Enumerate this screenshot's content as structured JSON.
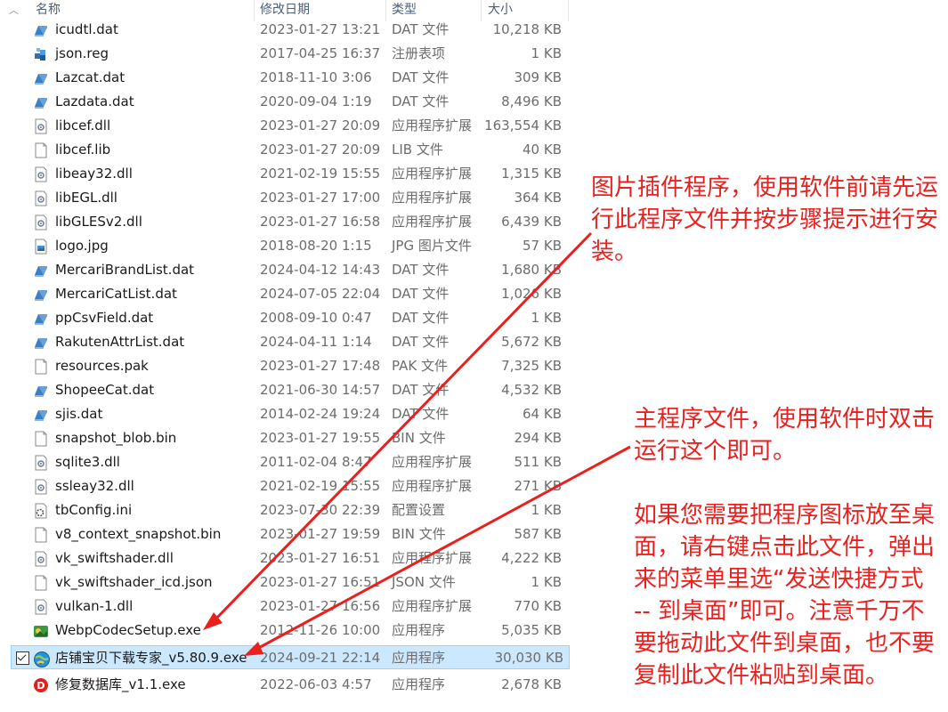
{
  "header": {
    "col_name": "名称",
    "col_date": "修改日期",
    "col_type": "类型",
    "col_size": "大小"
  },
  "files": [
    {
      "name": "icudtl.dat",
      "date": "2023-01-27 13:21",
      "type": "DAT 文件",
      "size": "10,218 KB",
      "icon": "dat-file-icon"
    },
    {
      "name": "json.reg",
      "date": "2017-04-25 16:37",
      "type": "注册表项",
      "size": "1 KB",
      "icon": "registry-file-icon"
    },
    {
      "name": "Lazcat.dat",
      "date": "2018-11-10 3:06",
      "type": "DAT 文件",
      "size": "309 KB",
      "icon": "dat-file-icon"
    },
    {
      "name": "Lazdata.dat",
      "date": "2020-09-04 1:19",
      "type": "DAT 文件",
      "size": "8,496 KB",
      "icon": "dat-file-icon"
    },
    {
      "name": "libcef.dll",
      "date": "2023-01-27 20:09",
      "type": "应用程序扩展",
      "size": "163,554 KB",
      "icon": "dll-file-icon"
    },
    {
      "name": "libcef.lib",
      "date": "2023-01-27 20:09",
      "type": "LIB 文件",
      "size": "40 KB",
      "icon": "blank-file-icon"
    },
    {
      "name": "libeay32.dll",
      "date": "2021-02-19 15:55",
      "type": "应用程序扩展",
      "size": "1,315 KB",
      "icon": "dll-file-icon"
    },
    {
      "name": "libEGL.dll",
      "date": "2023-01-27 17:00",
      "type": "应用程序扩展",
      "size": "364 KB",
      "icon": "dll-file-icon"
    },
    {
      "name": "libGLESv2.dll",
      "date": "2023-01-27 16:58",
      "type": "应用程序扩展",
      "size": "6,439 KB",
      "icon": "dll-file-icon"
    },
    {
      "name": "logo.jpg",
      "date": "2018-08-20 1:15",
      "type": "JPG 图片文件",
      "size": "57 KB",
      "icon": "image-file-icon"
    },
    {
      "name": "MercariBrandList.dat",
      "date": "2024-04-12 14:43",
      "type": "DAT 文件",
      "size": "1,680 KB",
      "icon": "dat-file-icon"
    },
    {
      "name": "MercariCatList.dat",
      "date": "2024-07-05 22:04",
      "type": "DAT 文件",
      "size": "1,026 KB",
      "icon": "dat-file-icon"
    },
    {
      "name": "ppCsvField.dat",
      "date": "2008-09-10 0:47",
      "type": "DAT 文件",
      "size": "1 KB",
      "icon": "dat-file-icon"
    },
    {
      "name": "RakutenAttrList.dat",
      "date": "2024-04-11 1:14",
      "type": "DAT 文件",
      "size": "5,672 KB",
      "icon": "dat-file-icon"
    },
    {
      "name": "resources.pak",
      "date": "2023-01-27 17:48",
      "type": "PAK 文件",
      "size": "7,325 KB",
      "icon": "blank-file-icon"
    },
    {
      "name": "ShopeeCat.dat",
      "date": "2021-06-30 14:57",
      "type": "DAT 文件",
      "size": "4,532 KB",
      "icon": "dat-file-icon"
    },
    {
      "name": "sjis.dat",
      "date": "2014-02-24 19:24",
      "type": "DAT 文件",
      "size": "64 KB",
      "icon": "dat-file-icon"
    },
    {
      "name": "snapshot_blob.bin",
      "date": "2023-01-27 19:55",
      "type": "BIN 文件",
      "size": "294 KB",
      "icon": "blank-file-icon"
    },
    {
      "name": "sqlite3.dll",
      "date": "2011-02-04 8:47",
      "type": "应用程序扩展",
      "size": "511 KB",
      "icon": "dll-file-icon"
    },
    {
      "name": "ssleay32.dll",
      "date": "2021-02-19 15:55",
      "type": "应用程序扩展",
      "size": "271 KB",
      "icon": "dll-file-icon"
    },
    {
      "name": "tbConfig.ini",
      "date": "2023-07-30 22:39",
      "type": "配置设置",
      "size": "1 KB",
      "icon": "ini-file-icon"
    },
    {
      "name": "v8_context_snapshot.bin",
      "date": "2023-01-27 19:59",
      "type": "BIN 文件",
      "size": "587 KB",
      "icon": "blank-file-icon"
    },
    {
      "name": "vk_swiftshader.dll",
      "date": "2023-01-27 16:51",
      "type": "应用程序扩展",
      "size": "4,222 KB",
      "icon": "dll-file-icon"
    },
    {
      "name": "vk_swiftshader_icd.json",
      "date": "2023-01-27 16:51",
      "type": "JSON 文件",
      "size": "1 KB",
      "icon": "blank-file-icon"
    },
    {
      "name": "vulkan-1.dll",
      "date": "2023-01-27 16:56",
      "type": "应用程序扩展",
      "size": "770 KB",
      "icon": "dll-file-icon"
    },
    {
      "name": "WebpCodecSetup.exe",
      "date": "2012-11-26 10:00",
      "type": "应用程序",
      "size": "5,035 KB",
      "icon": "webp-installer-icon"
    },
    {
      "name": "店铺宝贝下载专家_v5.80.9.exe",
      "date": "2024-09-21 22:14",
      "type": "应用程序",
      "size": "30,030 KB",
      "icon": "app-globe-icon",
      "selected": true
    },
    {
      "name": "修复数据库_v1.1.exe",
      "date": "2022-06-03 4:57",
      "type": "应用程序",
      "size": "2,678 KB",
      "icon": "repair-app-icon"
    }
  ],
  "annotations": {
    "annot1": "图片插件程序，使用软件前请先运行此程序文件并按步骤提示进行安装。",
    "annot2": "主程序文件，使用软件时双击运行这个即可。",
    "annot3": "如果您需要把程序图标放至桌面，请右键点击此文件，弹出来的菜单里选“发送快捷方式 -- 到桌面”即可。注意千万不要拖动此文件到桌面，也不要复制此文件粘贴到桌面。"
  },
  "colors": {
    "annotation_red": "#e8211f",
    "selection_bg": "#cce8ff",
    "selection_border": "#99d1ff"
  }
}
